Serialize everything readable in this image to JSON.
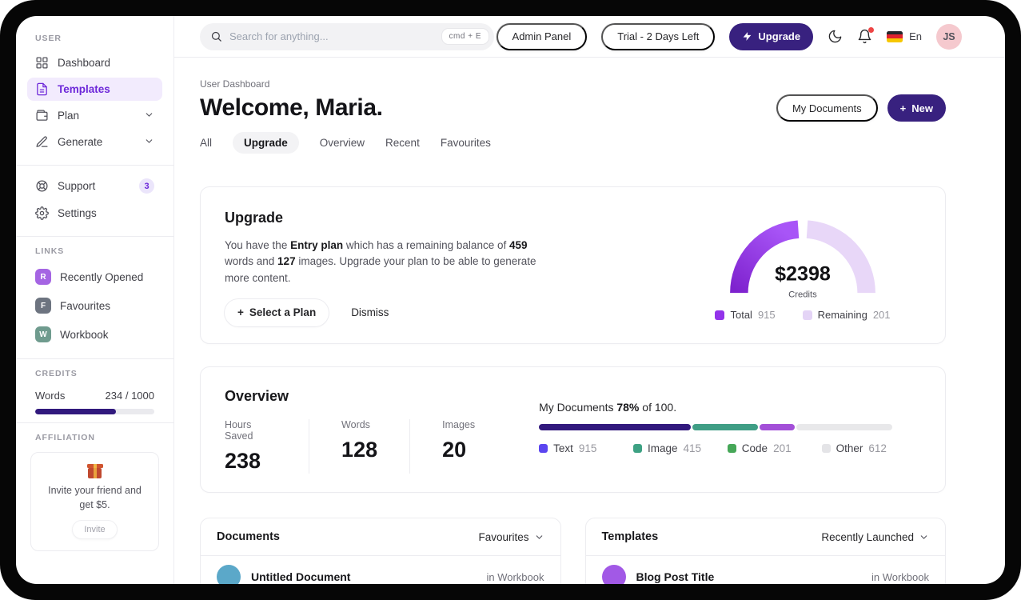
{
  "colors": {
    "accent": "#38217f",
    "gauge_total_from": "#7e22ce",
    "gauge_total_to": "#a855f7",
    "gauge_remaining": "#e8d7f8",
    "legend_total": "#9333ea",
    "legend_remaining": "#e4d4f6",
    "bar_text": "#31197d",
    "bar_image": "#3f9e85",
    "bar_code": "#a34fd8",
    "bar_track": "#e8e8ea",
    "legend_text": "#5b45f0",
    "legend_image": "#3da183",
    "legend_code": "#46a758",
    "legend_other": "#e4e4e7",
    "credits_fill": "#31197d",
    "badge_r": "#a565e3",
    "badge_f": "#6d7480",
    "badge_w": "#6f9b8e",
    "avatar_bg": "#f5c9ce",
    "doc_avatar": "#5ba8c9",
    "template_avatar": "#a259e6",
    "flag_top": "#26272b",
    "flag_mid": "#e0222e",
    "flag_bottom": "#f6c700"
  },
  "topbar": {
    "search": {
      "placeholder": "Search for anything...",
      "shortcut": "cmd + E"
    },
    "admin_panel": "Admin Panel",
    "trial": "Trial - 2 Days Left",
    "upgrade": "Upgrade",
    "language": "En",
    "avatar": "JS"
  },
  "sidebar": {
    "section_user": "USER",
    "section_links": "LINKS",
    "section_credits": "CREDITS",
    "section_affiliation": "AFFILIATION",
    "nav": [
      {
        "label": "Dashboard"
      },
      {
        "label": "Templates"
      },
      {
        "label": "Plan"
      },
      {
        "label": "Generate"
      }
    ],
    "support": {
      "label": "Support",
      "badge": "3"
    },
    "settings": {
      "label": "Settings"
    },
    "links": [
      {
        "initial": "R",
        "label": "Recently Opened"
      },
      {
        "initial": "F",
        "label": "Favourites"
      },
      {
        "initial": "W",
        "label": "Workbook"
      }
    ],
    "credits": {
      "label": "Words",
      "value": "234 / 1000",
      "percent": 68
    },
    "affiliation": {
      "text": "Invite your friend and get $5.",
      "button": "Invite"
    }
  },
  "header": {
    "breadcrumb": "User Dashboard",
    "title": "Welcome, Maria.",
    "my_documents": "My Documents",
    "new_label": "New",
    "tabs": [
      "All",
      "Upgrade",
      "Overview",
      "Recent",
      "Favourites"
    ],
    "active_tab": "Upgrade"
  },
  "upgrade_card": {
    "title": "Upgrade",
    "body": {
      "p1": "You have the ",
      "b1": "Entry plan",
      "p2": " which has a remaining balance of ",
      "b2": "459",
      "p3": " words and ",
      "b3": "127",
      "p4": " images. Upgrade your plan to be able to generate more content."
    },
    "select_plan": "Select a Plan",
    "dismiss": "Dismiss",
    "gauge": {
      "value": "$2398",
      "label": "Credits",
      "legend": [
        {
          "label": "Total",
          "value": "915"
        },
        {
          "label": "Remaining",
          "value": "201"
        }
      ]
    }
  },
  "overview_card": {
    "title": "Overview",
    "stats": [
      {
        "label": "Hours Saved",
        "value": "238"
      },
      {
        "label": "Words",
        "value": "128"
      },
      {
        "label": "Images",
        "value": "20"
      }
    ],
    "progress": {
      "prefix": "My Documents ",
      "percent": "78%",
      "suffix": " of 100."
    },
    "segments": [
      {
        "label": "Text",
        "value": "915",
        "percent": 43
      },
      {
        "label": "Image",
        "value": "415",
        "percent": 18.5
      },
      {
        "label": "Code",
        "value": "201",
        "percent": 10
      },
      {
        "label": "Other",
        "value": "612",
        "percent": 0
      }
    ]
  },
  "documents_panel": {
    "title": "Documents",
    "filter": "Favourites",
    "rows": [
      {
        "title": "Untitled Document",
        "location": "in Workbook"
      }
    ]
  },
  "templates_panel": {
    "title": "Templates",
    "filter": "Recently Launched",
    "rows": [
      {
        "title": "Blog Post Title",
        "location": "in Workbook"
      }
    ]
  }
}
